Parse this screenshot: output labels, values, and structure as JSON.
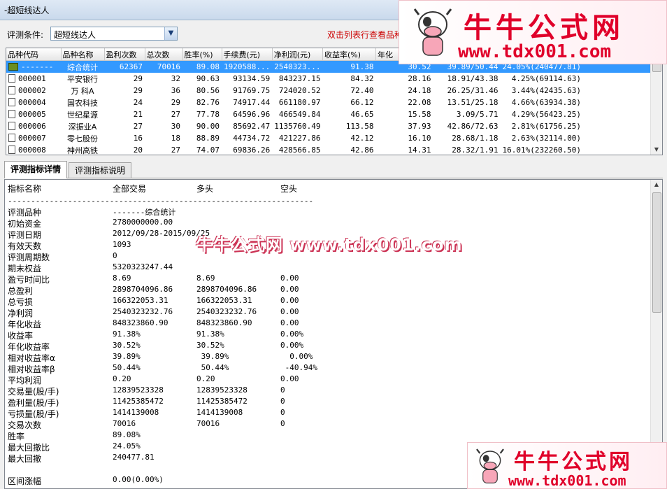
{
  "window": {
    "title": "-超短线达人"
  },
  "condition": {
    "label": "评测条件:",
    "value": "超短线达人",
    "hint": "双击列表行查看品种"
  },
  "list": {
    "columns": [
      "品种代码",
      "品种名称",
      "盈利次数",
      "总次数",
      "胜率(%)",
      "手续费(元)",
      "净利润(元)",
      "收益率(%)",
      "年化",
      "",
      "",
      ""
    ],
    "rows": [
      {
        "code": "-------",
        "name": "综合统计",
        "win": "62367",
        "total": "70016",
        "rate": "89.08",
        "fee": "1920588...",
        "profit": "2540323...",
        "ret": "91.38",
        "ann": "30.52",
        "x": "39.89/50.44",
        "y": "24.05%(240477.81)",
        "selected": true
      },
      {
        "code": "000001",
        "name": "平安银行",
        "win": "29",
        "total": "32",
        "rate": "90.63",
        "fee": "93134.59",
        "profit": "843237.15",
        "ret": "84.32",
        "ann": "28.16",
        "x": "18.91/43.38",
        "y": "4.25%(69114.63)"
      },
      {
        "code": "000002",
        "name": "万  科A",
        "win": "29",
        "total": "36",
        "rate": "80.56",
        "fee": "91769.75",
        "profit": "724020.52",
        "ret": "72.40",
        "ann": "24.18",
        "x": "26.25/31.46",
        "y": "3.44%(42435.63)"
      },
      {
        "code": "000004",
        "name": "国农科技",
        "win": "24",
        "total": "29",
        "rate": "82.76",
        "fee": "74917.44",
        "profit": "661180.97",
        "ret": "66.12",
        "ann": "22.08",
        "x": "13.51/25.18",
        "y": "4.66%(63934.38)"
      },
      {
        "code": "000005",
        "name": "世纪星源",
        "win": "21",
        "total": "27",
        "rate": "77.78",
        "fee": "64596.96",
        "profit": "466549.84",
        "ret": "46.65",
        "ann": "15.58",
        "x": "3.09/5.71",
        "y": "4.29%(56423.25)"
      },
      {
        "code": "000006",
        "name": "深振业A",
        "win": "27",
        "total": "30",
        "rate": "90.00",
        "fee": "85692.47",
        "profit": "1135760.49",
        "ret": "113.58",
        "ann": "37.93",
        "x": "42.86/72.63",
        "y": "2.81%(61756.25)"
      },
      {
        "code": "000007",
        "name": "零七股份",
        "win": "16",
        "total": "18",
        "rate": "88.89",
        "fee": "44734.72",
        "profit": "421227.86",
        "ret": "42.12",
        "ann": "16.10",
        "x": "28.68/1.18",
        "y": "2.63%(32114.00)"
      },
      {
        "code": "000008",
        "name": "神州高铁",
        "win": "20",
        "total": "27",
        "rate": "74.07",
        "fee": "69836.26",
        "profit": "428566.85",
        "ret": "42.86",
        "ann": "14.31",
        "x": "28.32/1.91",
        "y": "16.01%(232260.50)"
      }
    ]
  },
  "tabs": [
    {
      "label": "评测指标详情",
      "active": true
    },
    {
      "label": "评测指标说明",
      "active": false
    }
  ],
  "detail": {
    "header": [
      "指标名称",
      "全部交易",
      "多头",
      "空头"
    ],
    "separator": "------------------------------------------------------------------",
    "rows": [
      [
        "评测品种",
        "-------综合统计",
        "",
        ""
      ],
      [
        "初始资金",
        "2780000000.00",
        "",
        ""
      ],
      [
        "评测日期",
        "2012/09/28-2015/09/25",
        "",
        ""
      ],
      [
        "有效天数",
        "1093",
        "",
        ""
      ],
      [
        "评测周期数",
        "0",
        "",
        ""
      ],
      [
        "期末权益",
        "5320323247.44",
        "",
        ""
      ],
      [
        "盈亏时间比",
        "8.69",
        "8.69",
        "0.00"
      ],
      [
        "总盈利",
        "2898704096.86",
        "2898704096.86",
        "0.00"
      ],
      [
        "总亏损",
        "166322053.31",
        "166322053.31",
        "0.00"
      ],
      [
        "净利润",
        "2540323232.76",
        "2540323232.76",
        "0.00"
      ],
      [
        "年化收益",
        "848323860.90",
        "848323860.90",
        "0.00"
      ],
      [
        "收益率",
        "91.38%",
        "91.38%",
        "0.00%"
      ],
      [
        "年化收益率",
        "30.52%",
        "30.52%",
        "0.00%"
      ],
      [
        "相对收益率α",
        "39.89%",
        " 39.89%",
        "  0.00%"
      ],
      [
        "相对收益率β",
        "50.44%",
        " 50.44%",
        " -40.94%"
      ],
      [
        "平均利润",
        "0.20",
        "0.20",
        "0.00"
      ],
      [
        "交易量(股/手)",
        "12839523328",
        "12839523328",
        "0"
      ],
      [
        "盈利量(股/手)",
        "11425385472",
        "11425385472",
        "0"
      ],
      [
        "亏损量(股/手)",
        "1414139008",
        "1414139008",
        "0"
      ],
      [
        "交易次数",
        "70016",
        "70016",
        "0"
      ],
      [
        "胜率",
        "89.08%",
        "",
        ""
      ],
      [
        "最大回撤比",
        "24.05%",
        "",
        ""
      ],
      [
        "最大回撤",
        "240477.81",
        "",
        ""
      ],
      [
        "",
        "",
        "",
        ""
      ],
      [
        "区间涨幅",
        "0.00(0.00%)",
        "",
        ""
      ]
    ]
  },
  "watermark_mid": "牛牛公式网 www.tdx001.com",
  "banner_top": {
    "name": "牛牛公式网",
    "url": "www.tdx001.com"
  },
  "banner_bottom": {
    "name": "牛牛公式网",
    "url": "www.tdx001.com"
  },
  "colors": {
    "selection": "#3399ff",
    "hint": "#cc0000",
    "brand": "#e0002a"
  }
}
